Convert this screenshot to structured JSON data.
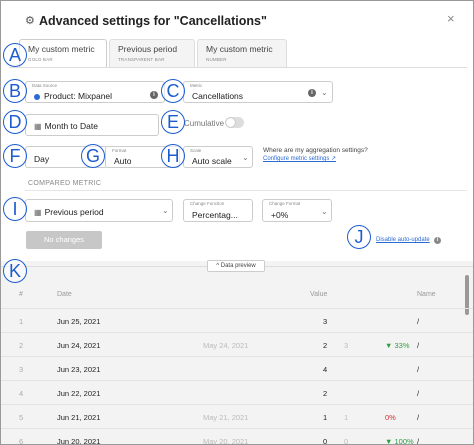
{
  "modal": {
    "title": "Advanced settings for \"Cancellations\"",
    "close_glyph": "×"
  },
  "tabs": [
    {
      "label": "My custom metric",
      "sub": "GOLD BAR"
    },
    {
      "label": "Previous period",
      "sub": "TRANSPARENT BAR"
    },
    {
      "label": "My custom metric",
      "sub": "NUMBER"
    }
  ],
  "form": {
    "data_source": {
      "label": "Data Source",
      "value": "Product: Mixpanel"
    },
    "metric": {
      "label": "Metric",
      "value": "Cancellations"
    },
    "date_range": {
      "value": "Month to Date"
    },
    "cumulative_label": "Cumulative",
    "granularity": {
      "value": "Day"
    },
    "format": {
      "label": "Format",
      "value": "Auto"
    },
    "scale": {
      "label": "Scale",
      "value": "Auto scale"
    },
    "aggregation_question": "Where are my aggregation settings?",
    "aggregation_link": "Configure metric settings ↗"
  },
  "compared": {
    "section_label": "COMPARED METRIC",
    "period": {
      "value": "Previous period"
    },
    "change_function": {
      "label": "Change Function",
      "value": "Percentag..."
    },
    "change_format": {
      "label": "Change Format",
      "value": "+0%"
    },
    "no_changes_button": "No changes",
    "disable_autoupdate": "Disable auto-update"
  },
  "preview": {
    "button_label": "^ Data preview",
    "headers": {
      "idx": "#",
      "date": "Date",
      "value": "Value",
      "name": "Name"
    },
    "rows": [
      {
        "idx": "1",
        "date": "Jun 25, 2021",
        "prev_date": "",
        "value": "3",
        "prev_value": "",
        "change": "",
        "dir": "",
        "name": "/"
      },
      {
        "idx": "2",
        "date": "Jun 24, 2021",
        "prev_date": "May 24, 2021",
        "value": "2",
        "prev_value": "3",
        "change": "▼ 33%",
        "dir": "up",
        "name": "/"
      },
      {
        "idx": "3",
        "date": "Jun 23, 2021",
        "prev_date": "",
        "value": "4",
        "prev_value": "",
        "change": "",
        "dir": "",
        "name": "/"
      },
      {
        "idx": "4",
        "date": "Jun 22, 2021",
        "prev_date": "",
        "value": "2",
        "prev_value": "",
        "change": "",
        "dir": "",
        "name": "/"
      },
      {
        "idx": "5",
        "date": "Jun 21, 2021",
        "prev_date": "May 21, 2021",
        "value": "1",
        "prev_value": "1",
        "change": "0%",
        "dir": "down",
        "name": "/"
      },
      {
        "idx": "6",
        "date": "Jun 20, 2021",
        "prev_date": "May 20, 2021",
        "value": "0",
        "prev_value": "0",
        "change": "▼ 100%",
        "dir": "up",
        "name": "/"
      }
    ]
  },
  "annotations": [
    "A",
    "B",
    "C",
    "D",
    "E",
    "F",
    "G",
    "H",
    "I",
    "J",
    "K"
  ],
  "colors": {
    "accent": "#2a6ad4",
    "marker": "#1c5ccf",
    "positive": "#2ea043",
    "negative": "#d32f2f"
  }
}
